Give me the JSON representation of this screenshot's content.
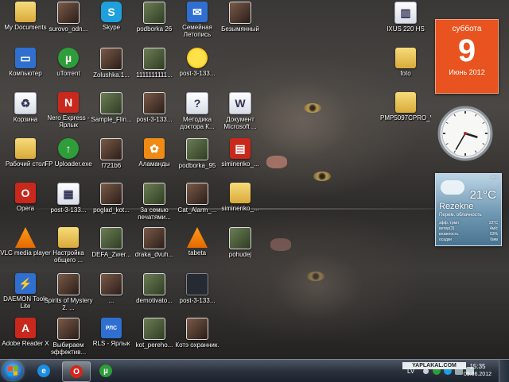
{
  "desktop": {
    "icons": [
      {
        "label": "My Documents",
        "kind": "folder"
      },
      {
        "label": "surovo_odn...",
        "kind": "pic2"
      },
      {
        "label": "Skype",
        "kind": "cyan",
        "symbol": "S"
      },
      {
        "label": "podborka 26",
        "kind": "pic"
      },
      {
        "label": "Семейная Летопись",
        "kind": "blue",
        "symbol": "✉"
      },
      {
        "label": "Безымянный",
        "kind": "pic2"
      },
      {
        "label": "Компьютер",
        "kind": "blue",
        "symbol": "▭"
      },
      {
        "label": "uTorrent",
        "kind": "green",
        "symbol": "µ"
      },
      {
        "label": "Zolushka.1...",
        "kind": "pic2"
      },
      {
        "label": "1111111111...",
        "kind": "pic"
      },
      {
        "label": "post-3-133...",
        "kind": "sun"
      },
      {
        "label": "Корзина",
        "kind": "doc",
        "symbol": "♻"
      },
      {
        "label": "Nero Express - Ярлык",
        "kind": "red",
        "symbol": "N"
      },
      {
        "label": "Sample_Flin...",
        "kind": "pic"
      },
      {
        "label": "post-3-133...",
        "kind": "pic2"
      },
      {
        "label": "Методика доктора К...",
        "kind": "doc",
        "symbol": "?"
      },
      {
        "label": "Документ Microsoft ...",
        "kind": "doc",
        "symbol": "W"
      },
      {
        "label": "Рабочий стол",
        "kind": "folder"
      },
      {
        "label": "FP Uploader.exe",
        "kind": "green",
        "symbol": "↑"
      },
      {
        "label": "f721b6",
        "kind": "pic2"
      },
      {
        "label": "Аламанды",
        "kind": "orange",
        "symbol": "✿"
      },
      {
        "label": "podborka_95",
        "kind": "pic"
      },
      {
        "label": "siminenko_...",
        "kind": "red",
        "symbol": "▤"
      },
      {
        "label": "Opera",
        "kind": "red",
        "symbol": "O"
      },
      {
        "label": "post-3-133...",
        "kind": "doc",
        "symbol": "▦"
      },
      {
        "label": "poglad_kot...",
        "kind": "pic2"
      },
      {
        "label": "За семью печатями...",
        "kind": "pic"
      },
      {
        "label": "Cat_Alarm_...",
        "kind": "pic2"
      },
      {
        "label": "siminenko_...",
        "kind": "folder"
      },
      {
        "label": "VLC media player",
        "kind": "vlc",
        "symbol": ""
      },
      {
        "label": "Настройка общего ...",
        "kind": "folder"
      },
      {
        "label": "DEFA_Zwer...",
        "kind": "pic"
      },
      {
        "label": "draka_dvuh...",
        "kind": "pic2"
      },
      {
        "label": "tabeta",
        "kind": "vlc",
        "symbol": ""
      },
      {
        "label": "pohudej",
        "kind": "pic"
      },
      {
        "label": "DAEMON Tools Lite",
        "kind": "blue",
        "symbol": "⚡"
      },
      {
        "label": "Spirits of Mystery 2. ...",
        "kind": "pic2"
      },
      {
        "label": "...",
        "kind": "pic2"
      },
      {
        "label": "demotivato...",
        "kind": "pic"
      },
      {
        "label": "post-3-133...",
        "kind": "dark"
      },
      {
        "label": "Adobe Reader X",
        "kind": "red",
        "symbol": "A"
      },
      {
        "label": "Выбираем эффектив...",
        "kind": "pic2"
      },
      {
        "label": "RLS - Ярлык",
        "kind": "blue",
        "symbol": "РЛС"
      },
      {
        "label": "kot_perehо...",
        "kind": "pic"
      },
      {
        "label": "Котэ охранник.",
        "kind": "pic2"
      },
      {
        "label": "IXUS 220 HS",
        "kind": "doc",
        "symbol": "▥"
      },
      {
        "label": "foto",
        "kind": "folder"
      },
      {
        "label": "PMP5097CPRO_V1.0.3_20120418",
        "kind": "folder"
      }
    ]
  },
  "gadgets": {
    "calendar": {
      "weekday": "суббота",
      "day": "9",
      "month_year": "Июнь 2012"
    },
    "clock": {
      "hour": 3,
      "minute": 35
    },
    "weather": {
      "temperature": "21°C",
      "city": "Rezekne",
      "condition": "Перем. облачность",
      "small": "15:57",
      "rows": [
        {
          "label": "эфф. трмп",
          "value": "22°C"
        },
        {
          "label": "ветер(З)",
          "value": "4м/с"
        },
        {
          "label": "влажность",
          "value": "63%"
        },
        {
          "label": "осадки",
          "value": "0мм"
        }
      ]
    }
  },
  "taskbar": {
    "pinned": [
      {
        "name": "internet-explorer",
        "symbol": "e",
        "color": "#1a8ee0"
      },
      {
        "name": "opera",
        "symbol": "O",
        "color": "#d0281e"
      },
      {
        "name": "utorrent",
        "symbol": "µ",
        "color": "#2e9d3a"
      }
    ],
    "tray": {
      "language": "LV",
      "time": "15:35",
      "date": "09.06.2012"
    }
  },
  "watermark": "YAPLAKAL.COM"
}
